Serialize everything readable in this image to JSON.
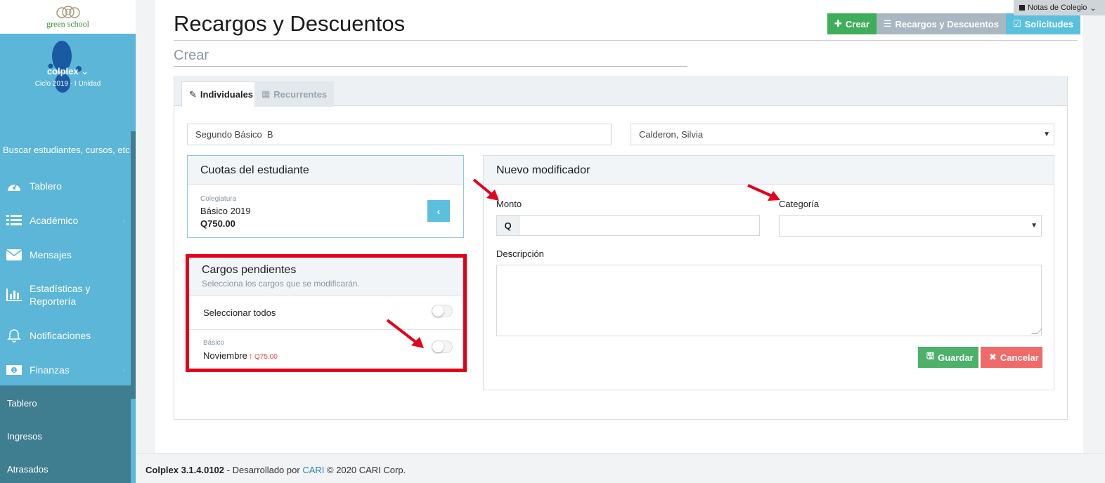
{
  "sidebar": {
    "school_name": "green school",
    "user_name": "colplex",
    "cycle": "Ciclo 2019 - I Unidad",
    "search_placeholder": "Buscar estudiantes, cursos, etc...",
    "items": [
      {
        "label": "Tablero",
        "icon": "dashboard-icon"
      },
      {
        "label": "Académico",
        "icon": "list-icon"
      },
      {
        "label": "Mensajes",
        "icon": "envelope-icon"
      },
      {
        "label": "Estadísticas y Reportería",
        "icon": "bar-chart-icon"
      },
      {
        "label": "Notificaciones",
        "icon": "bell-icon"
      },
      {
        "label": "Finanzas",
        "icon": "money-icon"
      }
    ],
    "sub_items": [
      "Tablero",
      "Ingresos",
      "Atrasados"
    ]
  },
  "header": {
    "title": "Recargos y Descuentos",
    "subtitle": "Crear",
    "btn_create": "Crear",
    "btn_recargos": "Recargos y Descuentos",
    "btn_solicitudes": "Solicitudes",
    "notas": "Notas de Colegio"
  },
  "tabs": [
    "Individuales",
    "Recurrentes"
  ],
  "selectors": {
    "course": "Segundo Básico  B",
    "student": "Calderon, Silvia"
  },
  "cuotas": {
    "title": "Cuotas del estudiante",
    "label": "Colegiatura",
    "name": "Básico 2019",
    "amount": "Q750.00"
  },
  "cargos": {
    "title": "Cargos pendientes",
    "subtitle": "Selecciona los cargos que se modificarán.",
    "select_all": "Seleccionar todos",
    "item_label": "Básico",
    "item_name": "Noviembre",
    "item_amount": "Q75.00"
  },
  "nuevo": {
    "title": "Nuevo modificador",
    "monto_label": "Monto",
    "currency": "Q",
    "categoria_label": "Categoría",
    "descripcion_label": "Descripción",
    "save": "Guardar",
    "cancel": "Cancelar"
  },
  "footer": {
    "version": "Colplex 3.1.4.0102",
    "dev_text": "- Desarrollado por",
    "link": "CARI",
    "copyright": "© 2020 CARI Corp."
  },
  "colors": {
    "sidebar": "#5bb6d8",
    "sidebar_sub": "#3f7d91",
    "highlight": "#e3001b",
    "green": "#3fae5a",
    "blue": "#5bc0de"
  }
}
